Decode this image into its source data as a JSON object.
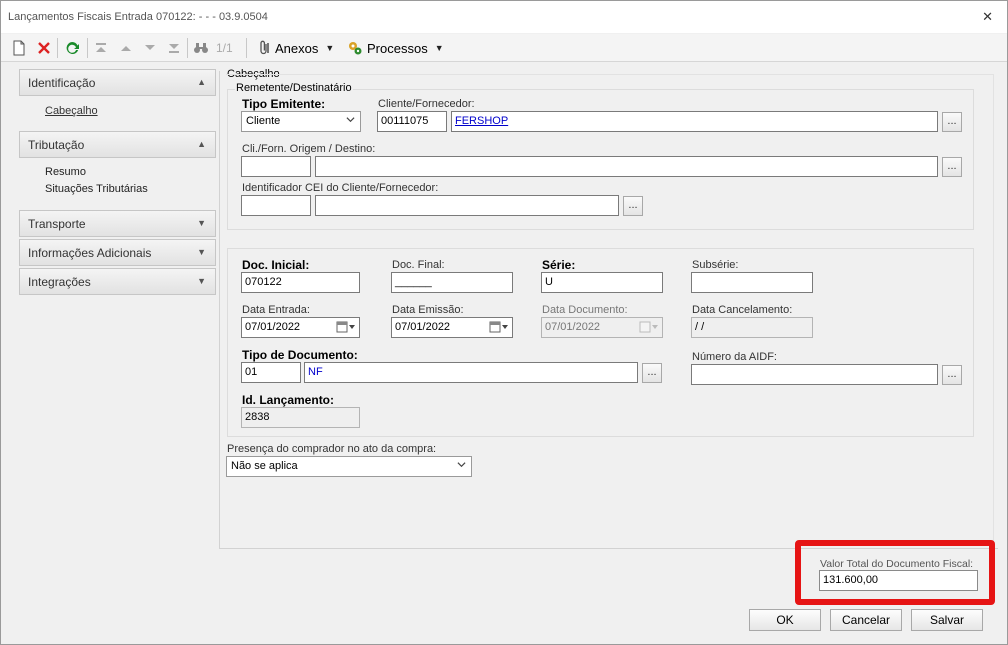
{
  "window": {
    "title": "Lançamentos Fiscais Entrada 070122:  -  -  - 03.9.0504"
  },
  "toolbar": {
    "page_counter": "1/1",
    "anexos_label": "Anexos",
    "processos_label": "Processos"
  },
  "nav": {
    "sections": [
      {
        "label": "Identificação",
        "links": [
          "Cabeçalho"
        ]
      },
      {
        "label": "Tributação",
        "links": [
          "Resumo",
          "Situações Tributárias"
        ]
      },
      {
        "label": "Transporte",
        "links": []
      },
      {
        "label": "Informações Adicionais",
        "links": []
      },
      {
        "label": "Integrações",
        "links": []
      }
    ]
  },
  "cabecalho": {
    "group_label": "Cabeçalho",
    "remetente": {
      "group_label": "Remetente/Destinatário",
      "tipo_emitente_label": "Tipo Emitente:",
      "tipo_emitente_value": "Cliente",
      "cliente_fornecedor_label": "Cliente/Fornecedor:",
      "cliente_code": "00111075",
      "cliente_name": "FERSHOP",
      "cli_origem_label": "Cli./Forn. Origem / Destino:",
      "cli_origem_code": "",
      "cli_origem_name": "",
      "cei_label": "Identificador CEI do Cliente/Fornecedor:",
      "cei_code": "",
      "cei_name": ""
    },
    "documento": {
      "doc_inicial_label": "Doc. Inicial:",
      "doc_inicial_value": "070122",
      "doc_final_label": "Doc. Final:",
      "doc_final_value": "______",
      "serie_label": "Série:",
      "serie_value": "U",
      "subserie_label": "Subsérie:",
      "subserie_value": "",
      "data_entrada_label": "Data Entrada:",
      "data_entrada_value": "07/01/2022",
      "data_emissao_label": "Data Emissão:",
      "data_emissao_value": "07/01/2022",
      "data_documento_label": "Data Documento:",
      "data_documento_value": "07/01/2022",
      "data_cancelamento_label": "Data Cancelamento:",
      "data_cancelamento_value": " /  /",
      "tipo_documento_label": "Tipo de Documento:",
      "tipo_documento_code": "01",
      "tipo_documento_name": "NF",
      "numero_aidf_label": "Número da AIDF:",
      "numero_aidf_value": "",
      "id_lancamento_label": "Id. Lançamento:",
      "id_lancamento_value": "2838"
    },
    "presenca_label": "Presença do comprador no ato da compra:",
    "presenca_value": "Não se aplica"
  },
  "total": {
    "label": "Valor Total do Documento Fiscal:",
    "value": "131.600,00"
  },
  "buttons": {
    "ok": "OK",
    "cancelar": "Cancelar",
    "salvar": "Salvar"
  },
  "colors": {
    "highlight": "#e61414",
    "link": "#0000cc"
  }
}
